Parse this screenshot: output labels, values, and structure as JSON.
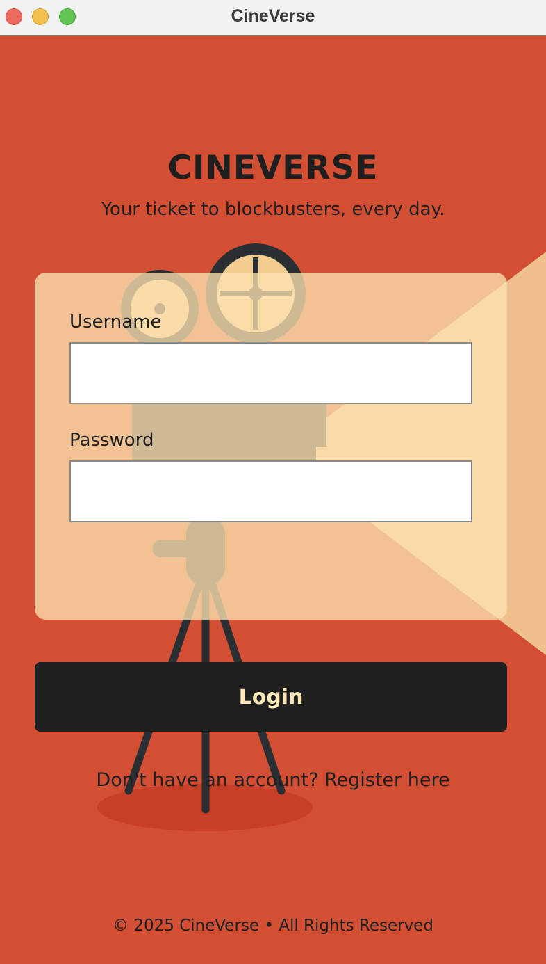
{
  "window": {
    "title": "CineVerse"
  },
  "header": {
    "brand": "CINEVERSE",
    "tagline": "Your ticket to blockbusters, every day."
  },
  "form": {
    "username_label": "Username",
    "username_value": "",
    "password_label": "Password",
    "password_value": ""
  },
  "actions": {
    "login_label": "Login",
    "register_text": "Don't have an account? Register here"
  },
  "footer": {
    "text": "© 2025 CineVerse • All Rights Reserved"
  },
  "colors": {
    "background": "#d24f34",
    "card": "#f6d39a",
    "button": "#1f1f1f",
    "button_text": "#fbe7b7",
    "text": "#1f1f1f"
  },
  "icons": [
    "film-projector-illustration",
    "light-beam"
  ]
}
